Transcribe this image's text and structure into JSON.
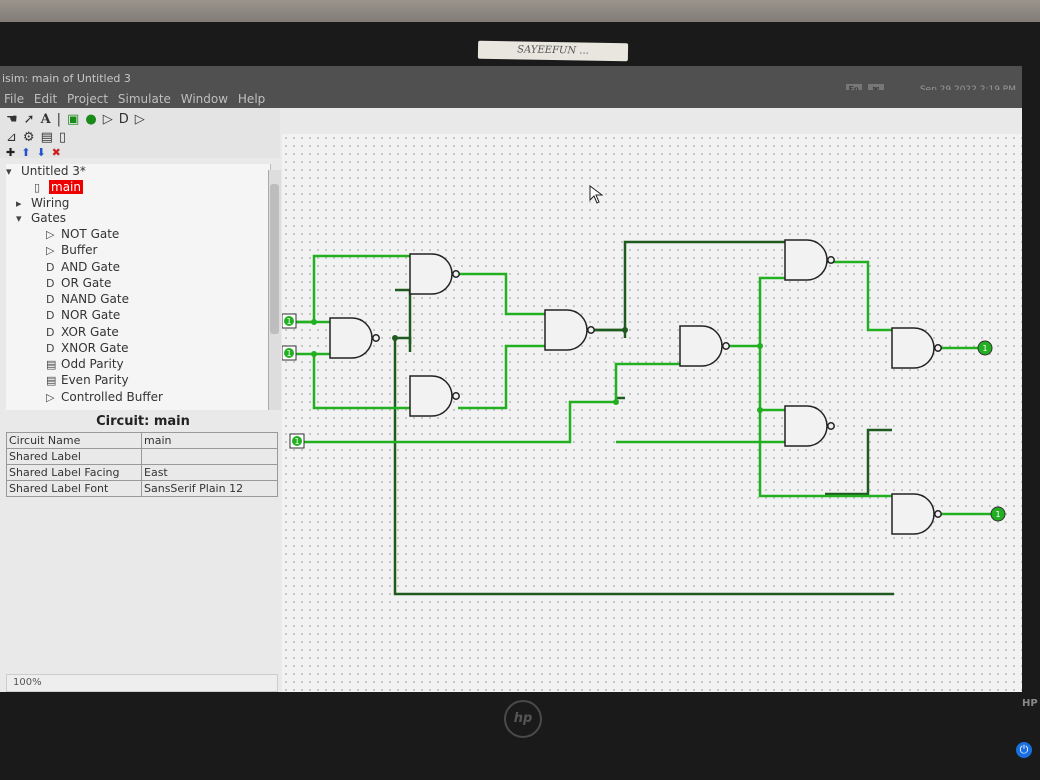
{
  "window": {
    "title": "isim: main of Untitled 3",
    "menu": [
      "File",
      "Edit",
      "Project",
      "Simulate",
      "Window",
      "Help"
    ],
    "clock": "Sep 29 2022  2:19 PM",
    "tray_badge": "En"
  },
  "sticker": "SAYEEFUN ...",
  "explorer": {
    "project": "Untitled 3*",
    "circuit": "main",
    "folders": [
      "Wiring",
      "Gates"
    ],
    "gates": [
      "NOT Gate",
      "Buffer",
      "AND Gate",
      "OR Gate",
      "NAND Gate",
      "NOR Gate",
      "XOR Gate",
      "XNOR Gate",
      "Odd Parity",
      "Even Parity",
      "Controlled Buffer"
    ]
  },
  "properties": {
    "header": "Circuit: main",
    "rows": [
      {
        "k": "Circuit Name",
        "v": "main"
      },
      {
        "k": "Shared Label",
        "v": ""
      },
      {
        "k": "Shared Label Facing",
        "v": "East"
      },
      {
        "k": "Shared Label Font",
        "v": "SansSerif Plain 12"
      }
    ]
  },
  "zoom": "100%",
  "pins": {
    "in": [
      "1",
      "1",
      "1"
    ],
    "out": [
      "1",
      "1"
    ]
  },
  "colors": {
    "wire_on": "#22b022",
    "wire_off": "#1f5a1f",
    "selected": "#e00000"
  },
  "monitor": {
    "brand": "HP",
    "logo": "hp"
  }
}
